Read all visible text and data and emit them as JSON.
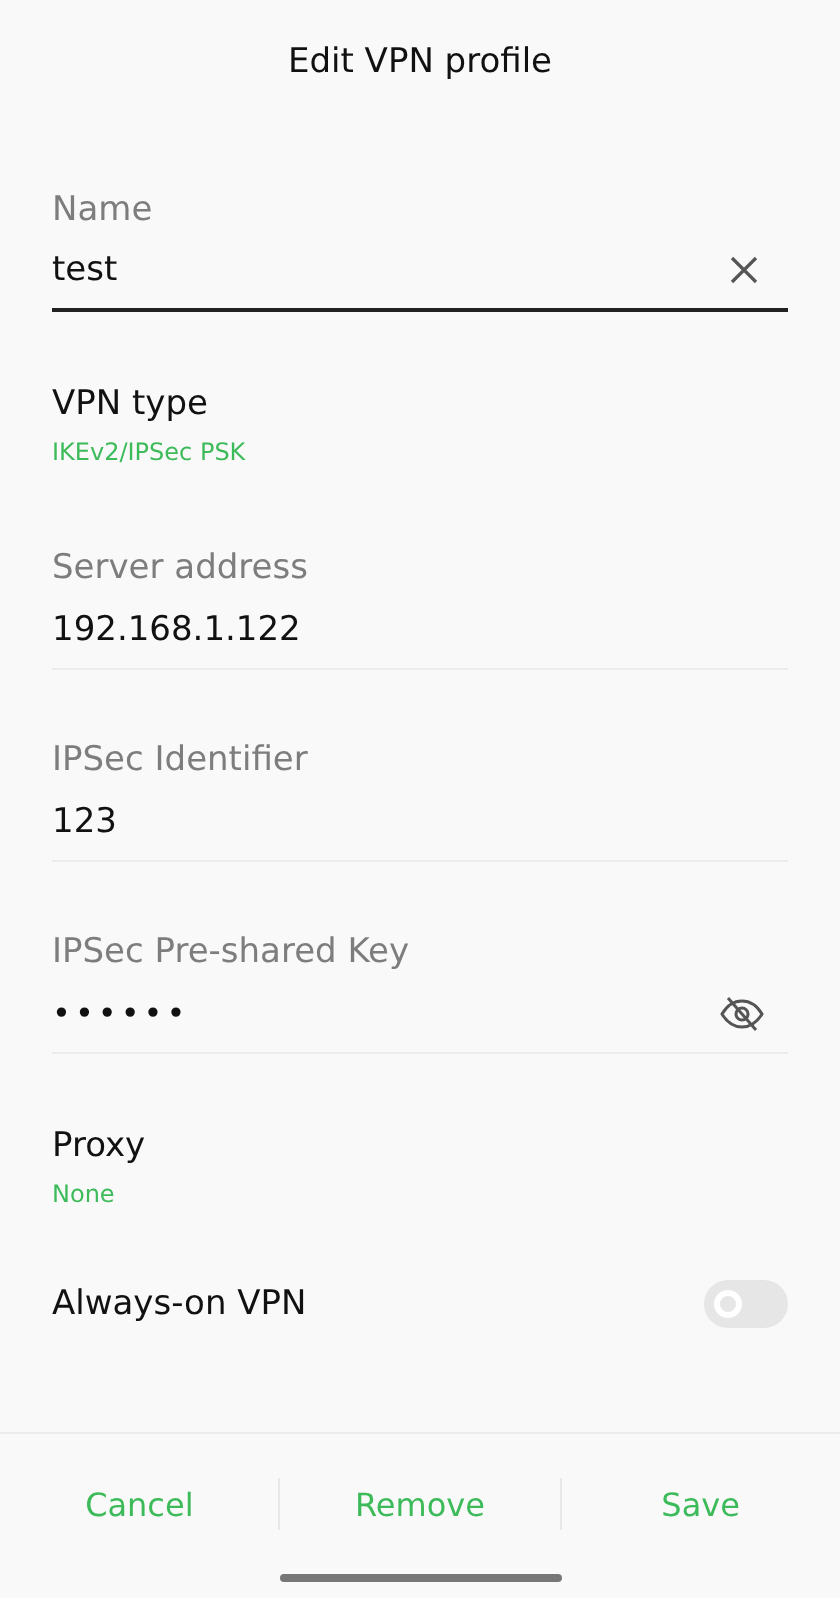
{
  "title": "Edit VPN profile",
  "fields": [
    {
      "kind": "input",
      "label": "Name",
      "value": "test",
      "focused": true
    },
    {
      "kind": "select",
      "label": "VPN type",
      "value": "IKEv2/IPSec PSK"
    },
    {
      "kind": "input",
      "label": "Server address",
      "value": "192.168.1.122",
      "focused": false
    },
    {
      "kind": "input",
      "label": "IPSec Identifier",
      "value": "123",
      "focused": false
    },
    {
      "kind": "password",
      "label": "IPSec Pre-shared Key",
      "value": "••••••",
      "masked": true
    },
    {
      "kind": "select",
      "label": "Proxy",
      "value": "None"
    },
    {
      "kind": "switch",
      "label": "Always-on VPN",
      "on": false
    }
  ],
  "buttons": [
    "Cancel",
    "Remove",
    "Save"
  ]
}
